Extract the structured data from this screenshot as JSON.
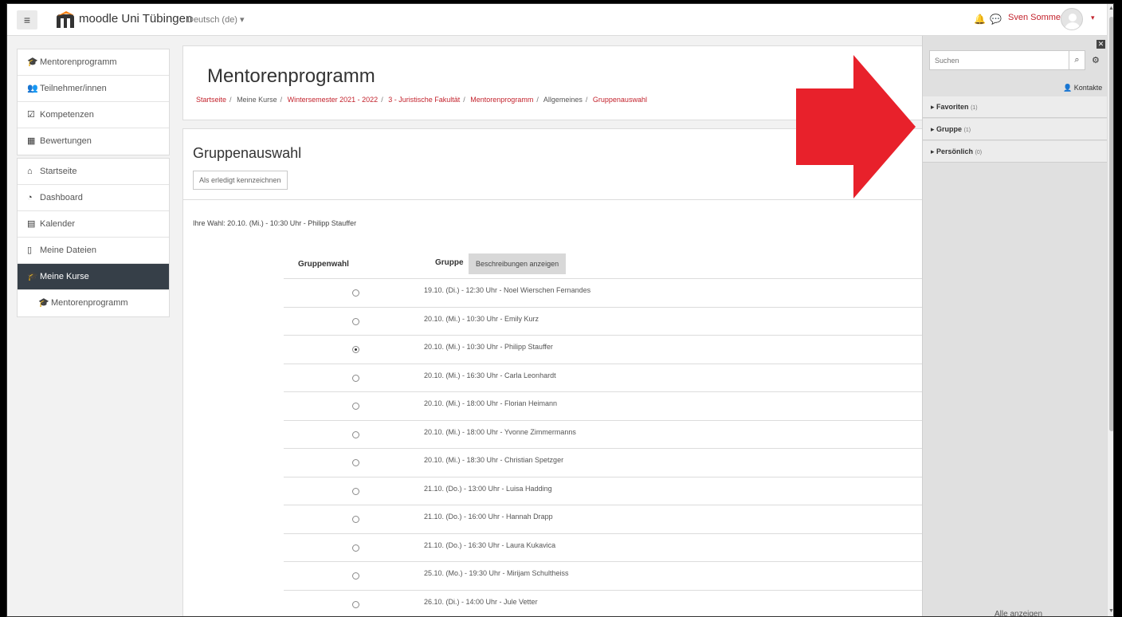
{
  "navbar": {
    "menu_icon": "hamburger-icon",
    "site_name": "moodle Uni Tübingen",
    "language": "Deutsch (de) ▾",
    "user_name": "Sven Sommer",
    "user_caret": "▾",
    "notification_icon": "bell-icon",
    "message_icon": "chat-icon"
  },
  "drawer": {
    "course_nav": [
      {
        "label": "Mentorenprogramm",
        "icon": "graduation-cap-icon",
        "glyph": "🎓"
      },
      {
        "label": "Teilnehmer/innen",
        "icon": "users-icon",
        "glyph": "👥"
      },
      {
        "label": "Kompetenzen",
        "icon": "checkbox-icon",
        "glyph": "☑"
      },
      {
        "label": "Bewertungen",
        "icon": "table-icon",
        "glyph": "▦"
      }
    ],
    "site_nav": [
      {
        "label": "Startseite",
        "icon": "home-icon",
        "glyph": "⌂"
      },
      {
        "label": "Dashboard",
        "icon": "dashboard-icon",
        "glyph": "◔"
      },
      {
        "label": "Kalender",
        "icon": "calendar-icon",
        "glyph": "▤"
      },
      {
        "label": "Meine Dateien",
        "icon": "file-icon",
        "glyph": "▯"
      },
      {
        "label": "Meine Kurse",
        "icon": "graduation-cap-icon",
        "glyph": "🎓"
      },
      {
        "label": "Mentorenprogramm",
        "icon": "graduation-cap-icon",
        "glyph": "🎓"
      }
    ]
  },
  "header": {
    "title": "Mentorenprogramm",
    "breadcrumb": [
      {
        "label": "Startseite",
        "link": true
      },
      {
        "label": "Meine Kurse",
        "link": false
      },
      {
        "label": "Wintersemester 2021 - 2022",
        "link": true
      },
      {
        "label": "3 - Juristische Fakultät",
        "link": true
      },
      {
        "label": "Mentorenprogramm",
        "link": true
      },
      {
        "label": "Allgemeines",
        "link": false
      },
      {
        "label": "Gruppenauswahl",
        "link": true
      }
    ]
  },
  "activity": {
    "title": "Gruppenauswahl",
    "completion_button": "Als erledigt kennzeichnen",
    "your_choice": "Ihre Wahl: 20.10. (Mi.) - 10:30 Uhr - Philipp Stauffer",
    "col_choice": "Gruppenwahl",
    "col_group": "Gruppe",
    "show_descriptions": "Beschreibungen anzeigen",
    "options": [
      {
        "label": "19.10. (Di.) - 12:30 Uhr - Noel Wierschen Fernandes",
        "selected": false
      },
      {
        "label": "20.10. (Mi.) - 10:30 Uhr - Emily Kurz",
        "selected": false
      },
      {
        "label": "20.10. (Mi.) - 10:30 Uhr - Philipp Stauffer",
        "selected": true
      },
      {
        "label": "20.10. (Mi.) - 16:30 Uhr - Carla Leonhardt",
        "selected": false
      },
      {
        "label": "20.10. (Mi.) - 18:00 Uhr - Florian Heimann",
        "selected": false
      },
      {
        "label": "20.10. (Mi.) - 18:00 Uhr - Yvonne Zimmermanns",
        "selected": false
      },
      {
        "label": "20.10. (Mi.) - 18:30 Uhr - Christian Spetzger",
        "selected": false
      },
      {
        "label": "21.10. (Do.) - 13:00 Uhr - Luisa Hadding",
        "selected": false
      },
      {
        "label": "21.10. (Do.) - 16:00 Uhr - Hannah Drapp",
        "selected": false
      },
      {
        "label": "21.10. (Do.) - 16:30 Uhr - Laura Kukavica",
        "selected": false
      },
      {
        "label": "25.10. (Mo.) - 19:30 Uhr - Mirijam Schultheiss",
        "selected": false
      },
      {
        "label": "26.10. (Di.) - 14:00 Uhr - Jule Vetter",
        "selected": false
      }
    ]
  },
  "messages": {
    "search_placeholder": "Suchen",
    "contacts": "Kontakte",
    "sections": [
      {
        "label": "Favoriten",
        "count": "(1)"
      },
      {
        "label": "Gruppe",
        "count": "(1)"
      },
      {
        "label": "Persönlich",
        "count": "(0)"
      }
    ],
    "show_all": "Alle anzeigen"
  },
  "colors": {
    "brand_red": "#c3232d",
    "arrow_red": "#e8212b",
    "active_nav": "#363f48",
    "logo_orange": "#f98012"
  }
}
